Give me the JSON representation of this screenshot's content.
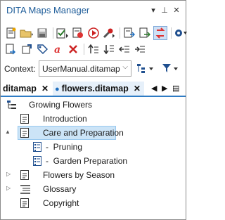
{
  "window": {
    "title": "DITA Maps Manager",
    "controls": [
      "▾",
      "⊥",
      "✕"
    ]
  },
  "toolbar": {
    "row1_icons": [
      "new-map-icon",
      "open-folder-icon",
      "save-icon",
      "validate-icon",
      "transform-icon",
      "run-icon",
      "configure-icon",
      "open-reference-icon",
      "link-icon",
      "sync-icon",
      "settings-icon"
    ],
    "row2_icons": [
      "insert-topic-icon",
      "edit-properties-icon",
      "tag-icon",
      "conref-icon",
      "delete-icon",
      "move-up-icon",
      "move-down-icon",
      "promote-icon",
      "demote-icon"
    ]
  },
  "context": {
    "label": "Context:",
    "value": "UserManual.ditamap"
  },
  "tabs": [
    {
      "label": "ditamap",
      "close": "✕",
      "active": false
    },
    {
      "label": "flowers.ditamap",
      "close": "✕",
      "active": true
    }
  ],
  "tree": {
    "items": [
      {
        "label": "Growing Flowers",
        "kind": "map",
        "level": 0,
        "expander": ""
      },
      {
        "label": "Introduction",
        "kind": "topic",
        "level": 1,
        "expander": ""
      },
      {
        "label": "Care and Preparation",
        "kind": "topic",
        "level": 1,
        "expander": "▲",
        "selected": true
      },
      {
        "label": "Pruning",
        "kind": "task",
        "level": 2,
        "expander": ""
      },
      {
        "label": "Garden Preparation",
        "kind": "task",
        "level": 2,
        "expander": ""
      },
      {
        "label": "Flowers by Season",
        "kind": "topic",
        "level": 1,
        "expander": "▷"
      },
      {
        "label": "Glossary",
        "kind": "glossary",
        "level": 1,
        "expander": "▷"
      },
      {
        "label": "Copyright",
        "kind": "topic",
        "level": 1,
        "expander": ""
      }
    ]
  }
}
